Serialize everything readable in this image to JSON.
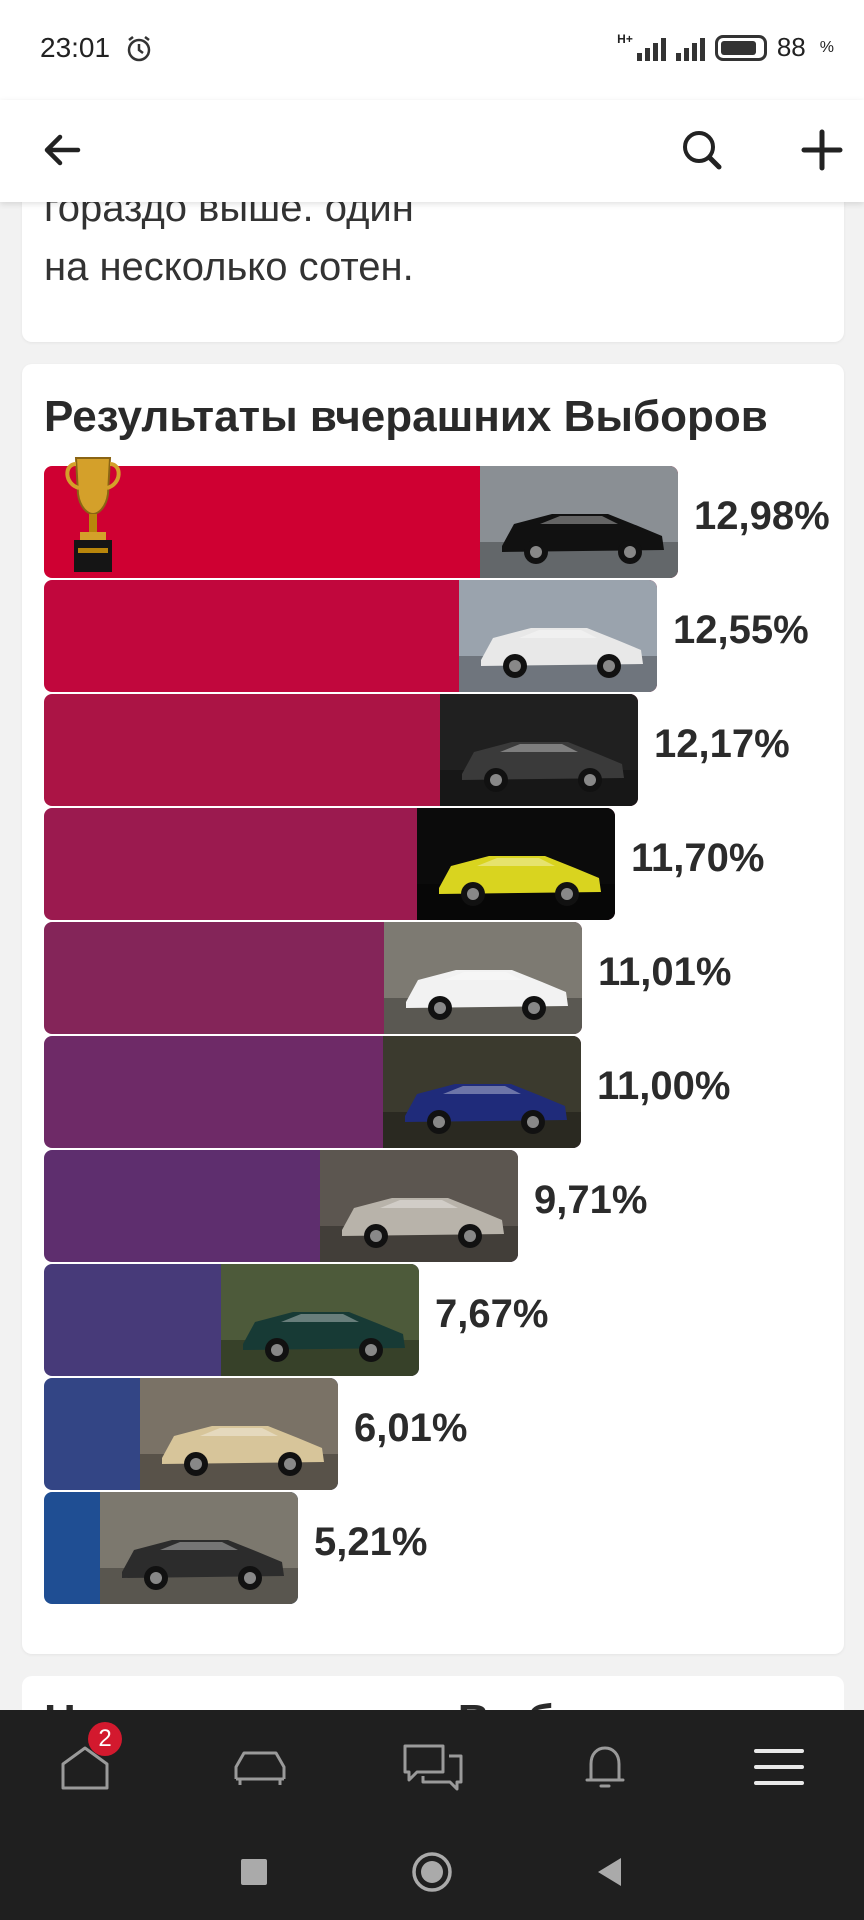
{
  "status_bar": {
    "time": "23:01",
    "network": "H+",
    "battery_level": "88",
    "battery_suffix": "%"
  },
  "toolbar": {
    "back_icon": "arrow-left-icon",
    "search_icon": "search-icon",
    "add_icon": "plus-icon"
  },
  "top_card": {
    "line1": "гораздо выше. один",
    "line2": "на несколько сотен."
  },
  "results": {
    "title": "Результаты вчерашних Выборов",
    "winner_icon": "trophy-icon",
    "items": [
      {
        "percent": "12,98%",
        "value": 12.98,
        "color": "#cf0032",
        "photo_bg": "#8a8f94",
        "car": "#111111"
      },
      {
        "percent": "12,55%",
        "value": 12.55,
        "color": "#c1073d",
        "photo_bg": "#9aa3ad",
        "car": "#e8e8e8"
      },
      {
        "percent": "12,17%",
        "value": 12.17,
        "color": "#ab1445",
        "photo_bg": "#202020",
        "car": "#3a3a3a"
      },
      {
        "percent": "11,70%",
        "value": 11.7,
        "color": "#9b1a4f",
        "photo_bg": "#0b0b0b",
        "car": "#d9d41f"
      },
      {
        "percent": "11,01%",
        "value": 11.01,
        "color": "#842559",
        "photo_bg": "#7d7a72",
        "car": "#f2f2f2"
      },
      {
        "percent": "11,00%",
        "value": 11.0,
        "color": "#6e2a67",
        "photo_bg": "#3b3a2e",
        "car": "#1f2b7a"
      },
      {
        "percent": "9,71%",
        "value": 9.71,
        "color": "#5e2e6e",
        "photo_bg": "#5c5650",
        "car": "#b8b3aa"
      },
      {
        "percent": "7,67%",
        "value": 7.67,
        "color": "#473a79",
        "photo_bg": "#4d5a3a",
        "car": "#173a35"
      },
      {
        "percent": "6,01%",
        "value": 6.01,
        "color": "#334585",
        "photo_bg": "#7a7266",
        "car": "#d7c59a"
      },
      {
        "percent": "5,21%",
        "value": 5.21,
        "color": "#1f4e93",
        "photo_bg": "#7c786e",
        "car": "#2c2c2c"
      }
    ]
  },
  "next_card": {
    "title": "Новые вчерашних Выборов"
  },
  "bottom_nav": {
    "home_badge": "2",
    "icons": [
      "home-icon",
      "car-icon",
      "messages-icon",
      "bell-icon",
      "menu-icon"
    ]
  },
  "system_nav": {
    "icons": [
      "recent-apps-icon",
      "home-circle-icon",
      "back-triangle-icon"
    ]
  }
}
